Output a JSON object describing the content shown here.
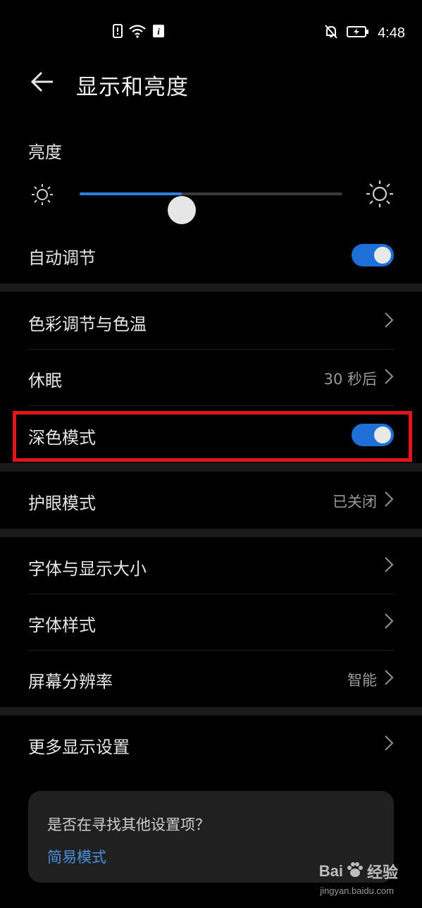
{
  "status_bar": {
    "time": "4:48",
    "icons_left": [
      "sim-alert-icon",
      "wifi-icon",
      "info-icon"
    ],
    "icons_right": [
      "bell-muted-icon",
      "battery-charging-icon"
    ]
  },
  "header": {
    "title": "显示和亮度",
    "back_icon": "arrow-left-icon"
  },
  "brightness": {
    "label": "亮度",
    "level_percent": 39,
    "colors": {
      "active": "#2f7fe0",
      "inactive": "#3a3a3a"
    }
  },
  "auto_adjust": {
    "label": "自动调节",
    "enabled": true
  },
  "rows": {
    "color_temp": {
      "label": "色彩调节与色温"
    },
    "sleep": {
      "label": "休眠",
      "value": "30 秒后"
    },
    "dark_mode": {
      "label": "深色模式",
      "enabled": true
    },
    "eye_comfort": {
      "label": "护眼模式",
      "value": "已关闭"
    },
    "font_size": {
      "label": "字体与显示大小"
    },
    "font_style": {
      "label": "字体样式"
    },
    "resolution": {
      "label": "屏幕分辨率",
      "value": "智能"
    },
    "more_display": {
      "label": "更多显示设置"
    }
  },
  "card": {
    "question": "是否在寻找其他设置项？",
    "link": "简易模式"
  },
  "watermark": {
    "brand_left": "Bai",
    "brand_right": "经验",
    "url": "jingyan.baidu.com"
  },
  "colors": {
    "toggle_on": "#1f6fd9",
    "highlight": "#e0161a",
    "link": "#4a90e2"
  }
}
